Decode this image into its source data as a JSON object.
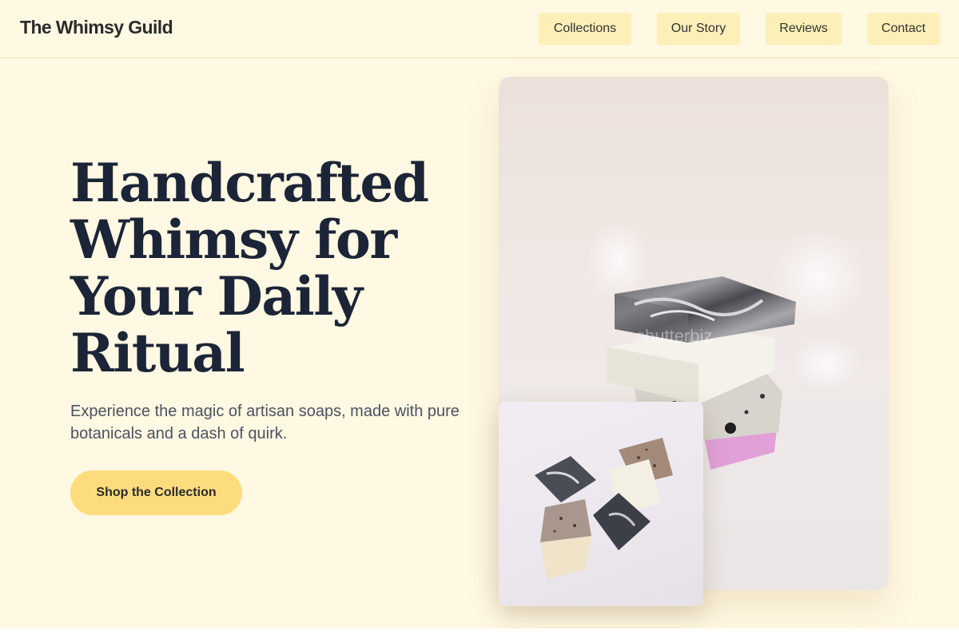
{
  "header": {
    "brand": "The Whimsy Guild",
    "nav": [
      "Collections",
      "Our Story",
      "Reviews",
      "Contact"
    ]
  },
  "hero": {
    "title": "Handcrafted Whimsy for Your Daily Ritual",
    "subtitle": "Experience the magic of artisan soaps, made with pure botanicals and a dash of quirk.",
    "cta_label": "Shop the Collection"
  },
  "images": {
    "main_watermark": "shutterbiz"
  },
  "colors": {
    "background": "#fff8e3",
    "nav_button": "#fdefb8",
    "cta": "#fcdc7c",
    "title_text": "#1c2537"
  }
}
